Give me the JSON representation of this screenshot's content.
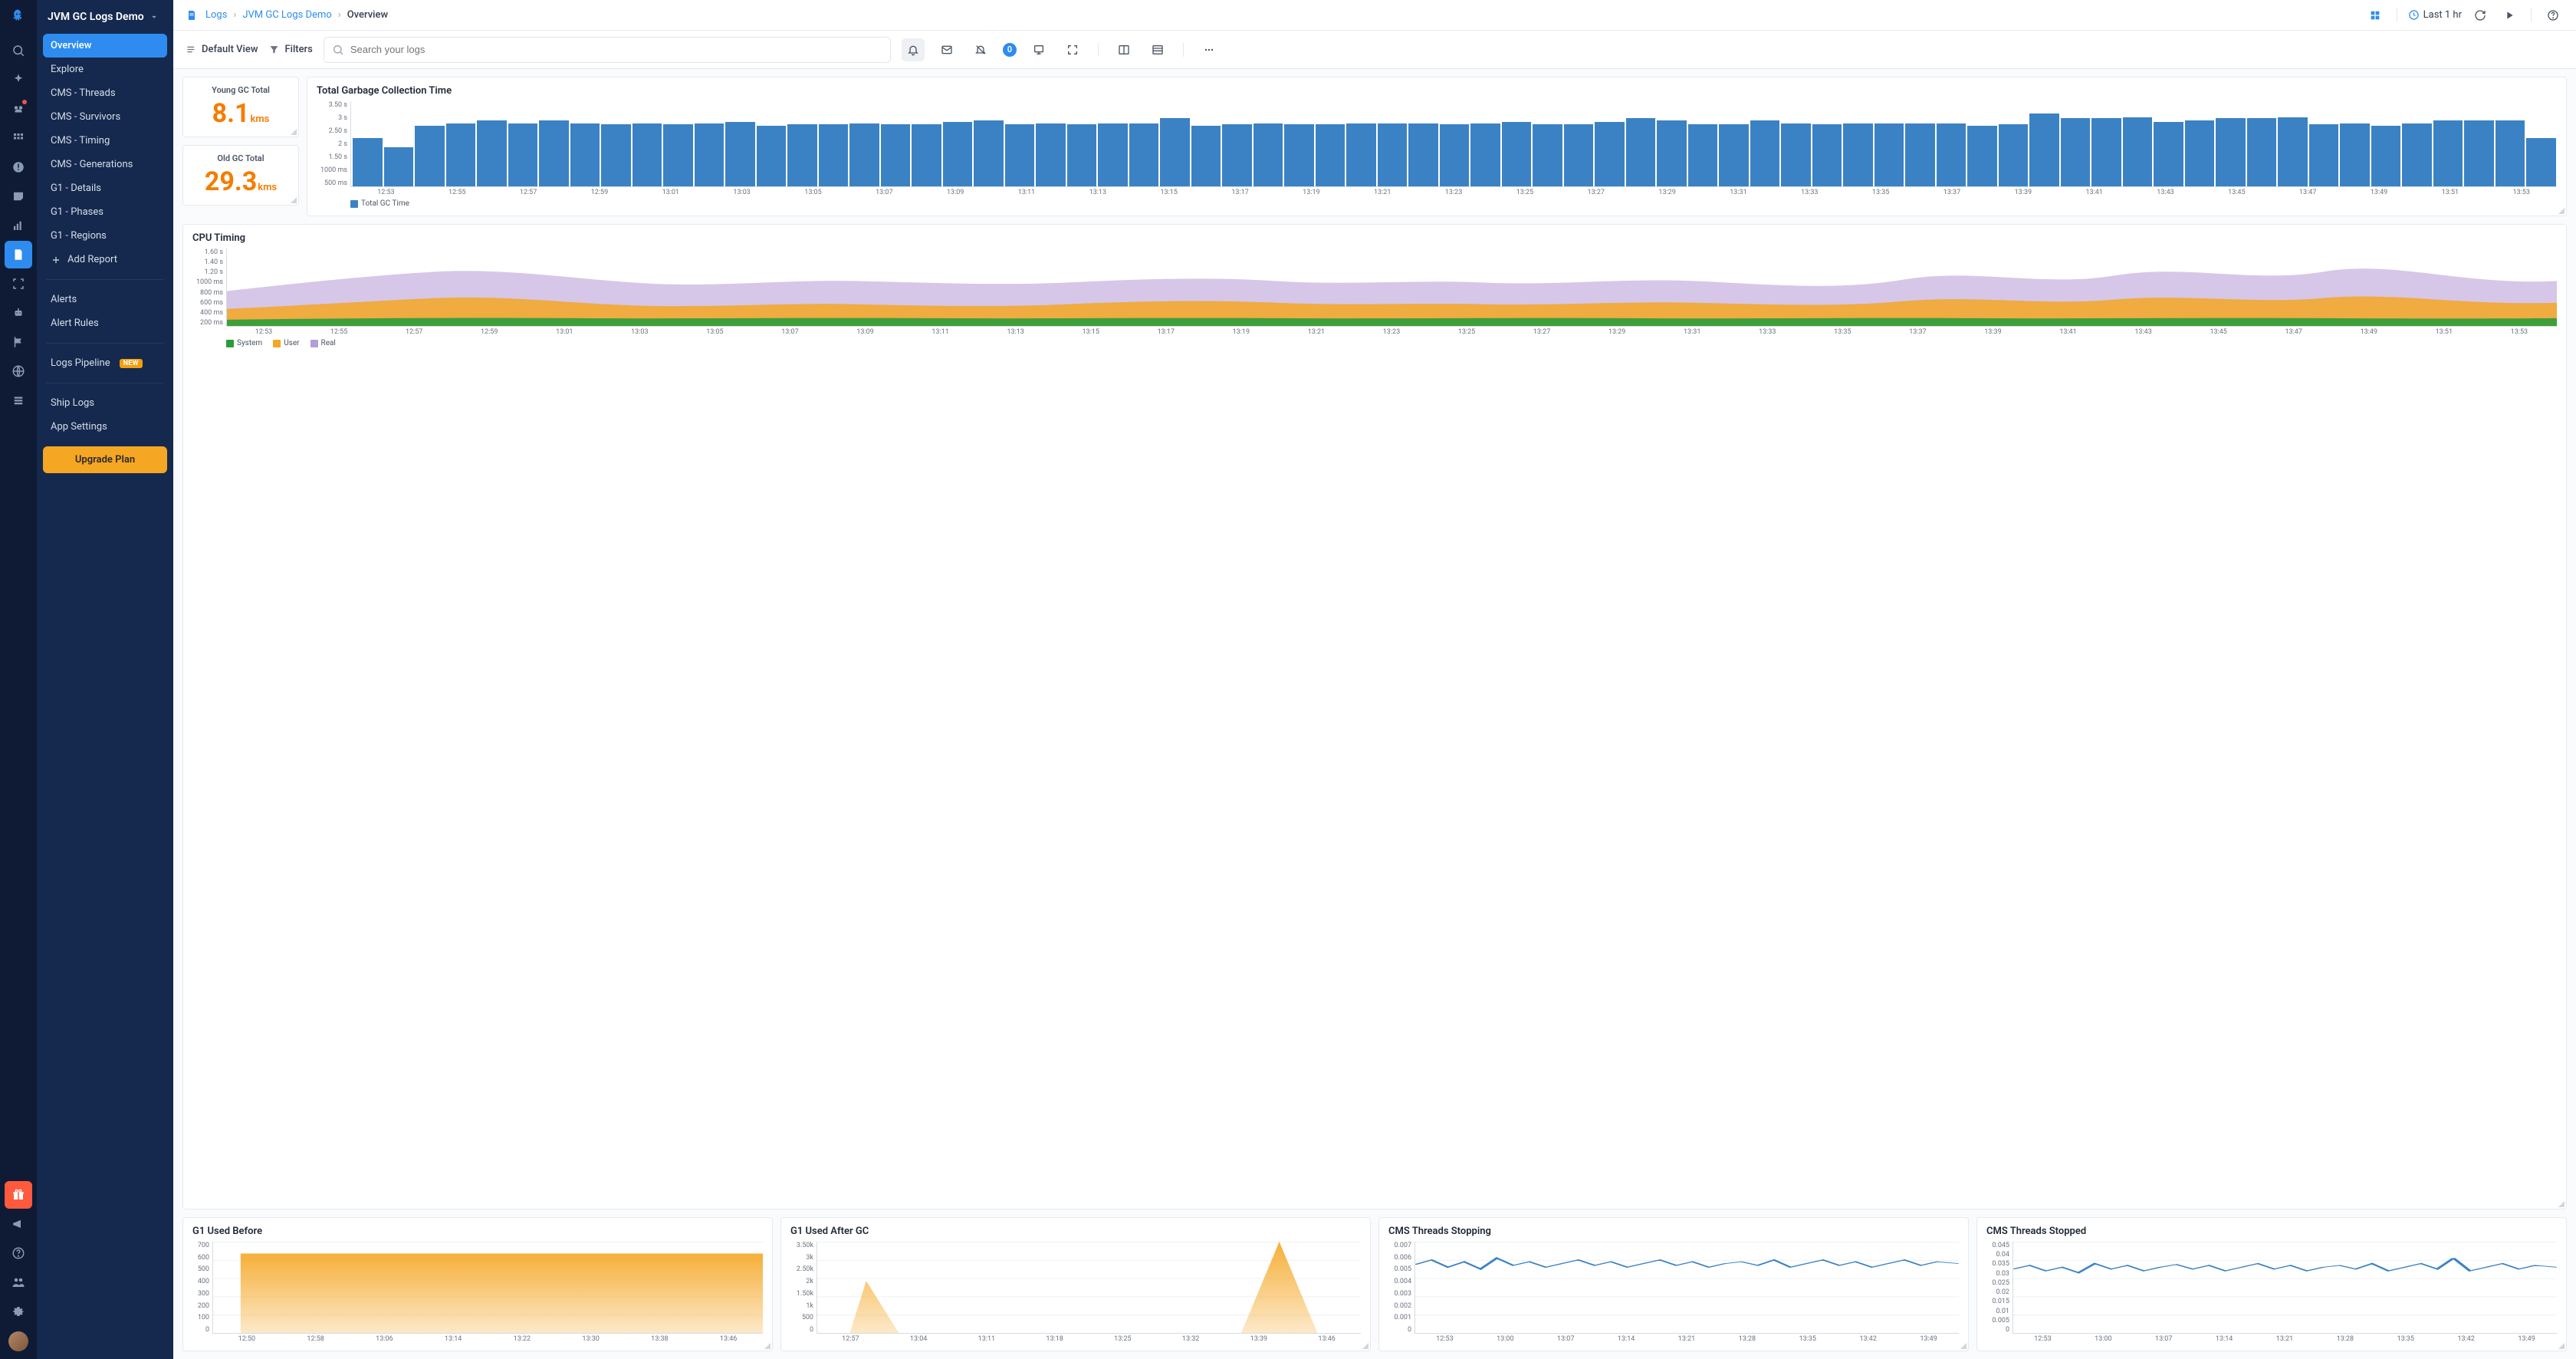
{
  "app_title": "JVM GC Logs Demo",
  "breadcrumbs": {
    "root": "Logs",
    "app": "JVM GC Logs Demo",
    "current": "Overview"
  },
  "time_range": "Last 1 hr",
  "toolbar": {
    "default_view": "Default View",
    "filters": "Filters",
    "search_placeholder": "Search your logs",
    "count_badge": "0"
  },
  "nav": {
    "items": [
      "Overview",
      "Explore",
      "CMS - Threads",
      "CMS - Survivors",
      "CMS - Timing",
      "CMS - Generations",
      "G1 - Details",
      "G1 - Phases",
      "G1 - Regions"
    ],
    "add_report": "Add Report",
    "alerts": "Alerts",
    "alert_rules": "Alert Rules",
    "logs_pipeline": "Logs Pipeline",
    "new_badge": "NEW",
    "ship_logs": "Ship Logs",
    "app_settings": "App Settings",
    "upgrade": "Upgrade Plan"
  },
  "stats": {
    "young": {
      "title": "Young GC Total",
      "value": "8.1",
      "unit": "kms"
    },
    "old": {
      "title": "Old GC Total",
      "value": "29.3",
      "unit": "kms"
    }
  },
  "chart_data": [
    {
      "id": "gc_time",
      "type": "bar",
      "title": "Total Garbage Collection Time",
      "ylabel_ticks": [
        "3.50 s",
        "3 s",
        "2.50 s",
        "2 s",
        "1.50 s",
        "1000 ms",
        "500 ms"
      ],
      "ylim": [
        0,
        3.5
      ],
      "x_ticks": [
        "12:53",
        "12:55",
        "12:57",
        "12:59",
        "13:01",
        "13:03",
        "13:05",
        "13:07",
        "13:09",
        "13:11",
        "13:13",
        "13:15",
        "13:17",
        "13:19",
        "13:21",
        "13:23",
        "13:25",
        "13:27",
        "13:29",
        "13:31",
        "13:33",
        "13:35",
        "13:37",
        "13:39",
        "13:41",
        "13:43",
        "13:45",
        "13:47",
        "13:49",
        "13:51",
        "13:53"
      ],
      "series": [
        {
          "name": "Total GC Time",
          "color": "#3b82c4",
          "values": [
            2.0,
            1.6,
            2.5,
            2.6,
            2.7,
            2.6,
            2.7,
            2.6,
            2.55,
            2.6,
            2.55,
            2.6,
            2.65,
            2.5,
            2.55,
            2.55,
            2.6,
            2.55,
            2.55,
            2.65,
            2.7,
            2.55,
            2.6,
            2.55,
            2.6,
            2.6,
            2.8,
            2.5,
            2.55,
            2.6,
            2.55,
            2.55,
            2.6,
            2.6,
            2.6,
            2.55,
            2.6,
            2.65,
            2.55,
            2.55,
            2.65,
            2.8,
            2.7,
            2.55,
            2.55,
            2.7,
            2.6,
            2.55,
            2.6,
            2.6,
            2.6,
            2.6,
            2.5,
            2.55,
            3.0,
            2.8,
            2.8,
            2.85,
            2.65,
            2.7,
            2.8,
            2.8,
            2.85,
            2.55,
            2.6,
            2.5,
            2.6,
            2.7,
            2.7,
            2.7,
            2.0
          ]
        }
      ],
      "legend": [
        {
          "label": "Total GC Time",
          "color": "#3b82c4"
        }
      ]
    },
    {
      "id": "cpu_timing",
      "type": "area",
      "title": "CPU Timing",
      "ylabel_ticks": [
        "1.60 s",
        "1.40 s",
        "1.20 s",
        "1000 ms",
        "800 ms",
        "600 ms",
        "400 ms",
        "200 ms"
      ],
      "ylim": [
        0,
        1.6
      ],
      "x_ticks": [
        "12:53",
        "12:55",
        "12:57",
        "12:59",
        "13:01",
        "13:03",
        "13:05",
        "13:07",
        "13:09",
        "13:11",
        "13:13",
        "13:15",
        "13:17",
        "13:19",
        "13:21",
        "13:23",
        "13:25",
        "13:27",
        "13:29",
        "13:31",
        "13:33",
        "13:35",
        "13:37",
        "13:39",
        "13:41",
        "13:43",
        "13:45",
        "13:47",
        "13:49",
        "13:51",
        "13:53"
      ],
      "series": [
        {
          "name": "System",
          "color": "#2a9d3a"
        },
        {
          "name": "User",
          "color": "#f5a623"
        },
        {
          "name": "Real",
          "color": "#b39ddb"
        }
      ],
      "legend": [
        {
          "label": "System",
          "color": "#2a9d3a"
        },
        {
          "label": "User",
          "color": "#f5a623"
        },
        {
          "label": "Real",
          "color": "#b39ddb"
        }
      ]
    },
    {
      "id": "g1_before",
      "type": "area",
      "title": "G1 Used Before",
      "ylabel_ticks": [
        "700",
        "600",
        "500",
        "400",
        "300",
        "200",
        "100",
        "0"
      ],
      "ylim": [
        0,
        700
      ],
      "x_ticks": [
        "12:50",
        "12:58",
        "13:06",
        "13:14",
        "13:22",
        "13:30",
        "13:38",
        "13:46"
      ],
      "series": [
        {
          "name": "G1 Used Before",
          "color": "#f5a623",
          "approx": "flat ~610 across range"
        }
      ]
    },
    {
      "id": "g1_after",
      "type": "area",
      "title": "G1 Used After GC",
      "ylabel_ticks": [
        "3.50k",
        "3k",
        "2.50k",
        "2k",
        "1.50k",
        "1k",
        "500",
        "0"
      ],
      "ylim": [
        0,
        3500
      ],
      "x_ticks": [
        "12:57",
        "13:04",
        "13:11",
        "13:18",
        "13:25",
        "13:32",
        "13:39",
        "13:46"
      ],
      "series": [
        {
          "name": "G1 Used After GC",
          "color": "#f5a623",
          "peaks": [
            {
              "t": "12:58",
              "v": 2000
            },
            {
              "t": "13:40",
              "v": 3500
            }
          ]
        }
      ]
    },
    {
      "id": "cms_stopping",
      "type": "line",
      "title": "CMS Threads Stopping",
      "ylabel_ticks": [
        "0.007",
        "0.006",
        "0.005",
        "0.004",
        "0.003",
        "0.002",
        "0.001",
        "0"
      ],
      "ylim": [
        0,
        0.007
      ],
      "x_ticks": [
        "12:53",
        "13:00",
        "13:07",
        "13:14",
        "13:21",
        "13:28",
        "13:35",
        "13:42",
        "13:49"
      ],
      "series": [
        {
          "name": "Stopping",
          "color": "#3b82c4",
          "approx_mean": 0.0055
        }
      ]
    },
    {
      "id": "cms_stopped",
      "type": "line",
      "title": "CMS Threads Stopped",
      "ylabel_ticks": [
        "0.045",
        "0.04",
        "0.035",
        "0.03",
        "0.025",
        "0.02",
        "0.015",
        "0.01",
        "0.005",
        "0"
      ],
      "ylim": [
        0,
        0.045
      ],
      "x_ticks": [
        "12:53",
        "13:00",
        "13:07",
        "13:14",
        "13:21",
        "13:28",
        "13:35",
        "13:42",
        "13:49"
      ],
      "series": [
        {
          "name": "Stopped",
          "color": "#3b82c4",
          "approx_mean": 0.032
        }
      ]
    }
  ]
}
